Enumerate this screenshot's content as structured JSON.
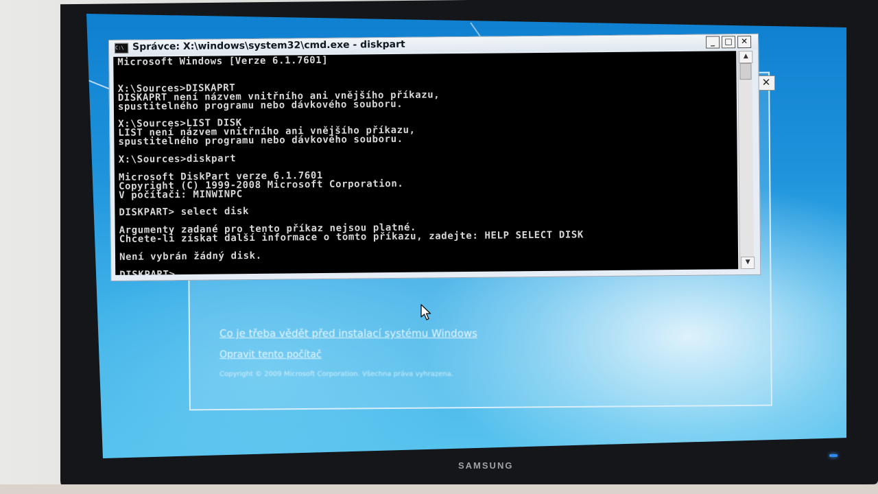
{
  "monitor": {
    "brand": "SAMSUNG"
  },
  "setup": {
    "close_glyph": "✕",
    "link_install_info": "Co je třeba vědět před instalací systému Windows",
    "link_repair": "Opravit tento počítač",
    "copyright": "Copyright © 2009 Microsoft Corporation. Všechna práva vyhrazena."
  },
  "cmd": {
    "icon_label": "C:\\",
    "title": "Správce: X:\\windows\\system32\\cmd.exe - diskpart",
    "minimize": "_",
    "maximize": "□",
    "close": "✕",
    "scroll_up": "▲",
    "scroll_down": "▼",
    "console_text": "Microsoft Windows [Verze 6.1.7601]\n\n\nX:\\Sources>DISKAPRT\nDISKAPRT není názvem vnitřního ani vnějšího příkazu,\nspustitelného programu nebo dávkového souboru.\n\nX:\\Sources>LIST DISK\nLIST není názvem vnitřního ani vnějšího příkazu,\nspustitelného programu nebo dávkového souboru.\n\nX:\\Sources>diskpart\n\nMicrosoft DiskPart verze 6.1.7601\nCopyright (C) 1999-2008 Microsoft Corporation.\nV počítači: MINWINPC\n\nDISKPART> select disk\n\nArgumenty zadané pro tento příkaz nejsou platné.\nChcete-li získat další informace o tomto příkazu, zadejte: HELP SELECT DISK\n\nNení vybrán žádný disk.\n\nDISKPART>"
  },
  "icons": {
    "cursor": "mouse-pointer-icon",
    "console": "console-icon"
  },
  "colors": {
    "console_bg": "#000000",
    "console_text": "#d8d8d8",
    "desktop_blue": "#1e93dc"
  }
}
